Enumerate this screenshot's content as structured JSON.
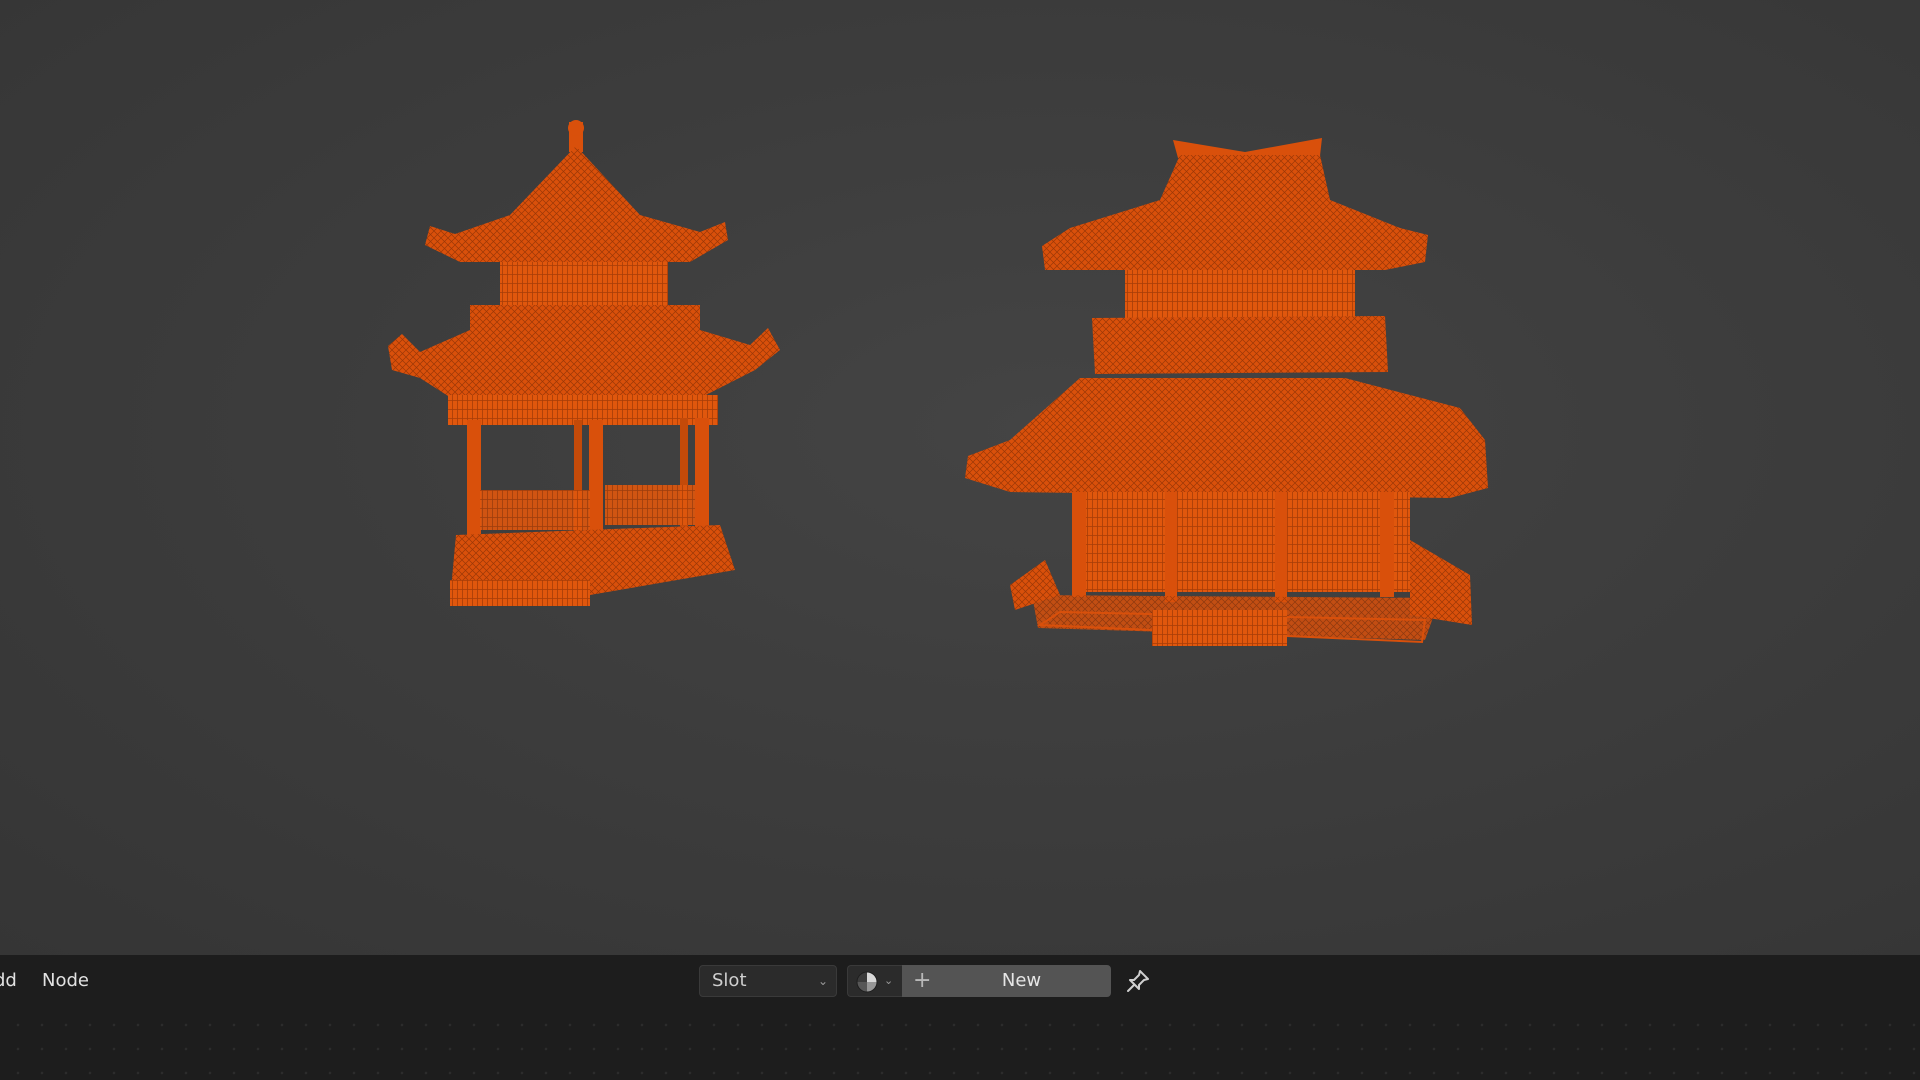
{
  "node_header": {
    "menu": {
      "add_label": "Add",
      "node_label": "Node"
    },
    "slot_selector": {
      "value": "Slot"
    },
    "material": {
      "browse_icon": "material-sphere-icon",
      "new_label": "New"
    },
    "pin_icon": "pin-icon"
  },
  "viewport": {
    "selection_color": "#e0540a",
    "objects": [
      "pagoda-pavilion",
      "two-story-temple"
    ]
  }
}
